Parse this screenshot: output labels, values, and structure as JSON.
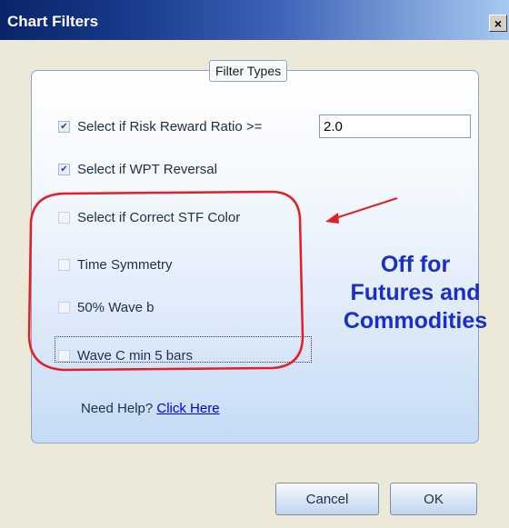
{
  "window": {
    "title": "Chart Filters",
    "close_label": "×"
  },
  "group": {
    "legend": "Filter Types"
  },
  "filters": [
    {
      "label": "Select if Risk Reward Ratio >=",
      "checked": true,
      "enabled": true
    },
    {
      "label": "Select if WPT Reversal",
      "checked": true,
      "enabled": true
    },
    {
      "label": "Select if Correct STF Color",
      "checked": false,
      "enabled": false
    },
    {
      "label": "Time Symmetry",
      "checked": false,
      "enabled": false
    },
    {
      "label": "50% Wave b",
      "checked": false,
      "enabled": false
    },
    {
      "label": "Wave C min 5 bars",
      "checked": false,
      "enabled": false
    }
  ],
  "ratio": {
    "value": "2.0"
  },
  "help": {
    "prefix": "Need Help?",
    "link": "Click Here"
  },
  "annotation": {
    "lines": [
      "Off for",
      "Futures and",
      "Commodities"
    ],
    "text_color": "#1a2ec8",
    "circle_color": "#e31e24",
    "arrow_color": "#e31e24"
  },
  "buttons": {
    "cancel": "Cancel",
    "ok": "OK"
  }
}
